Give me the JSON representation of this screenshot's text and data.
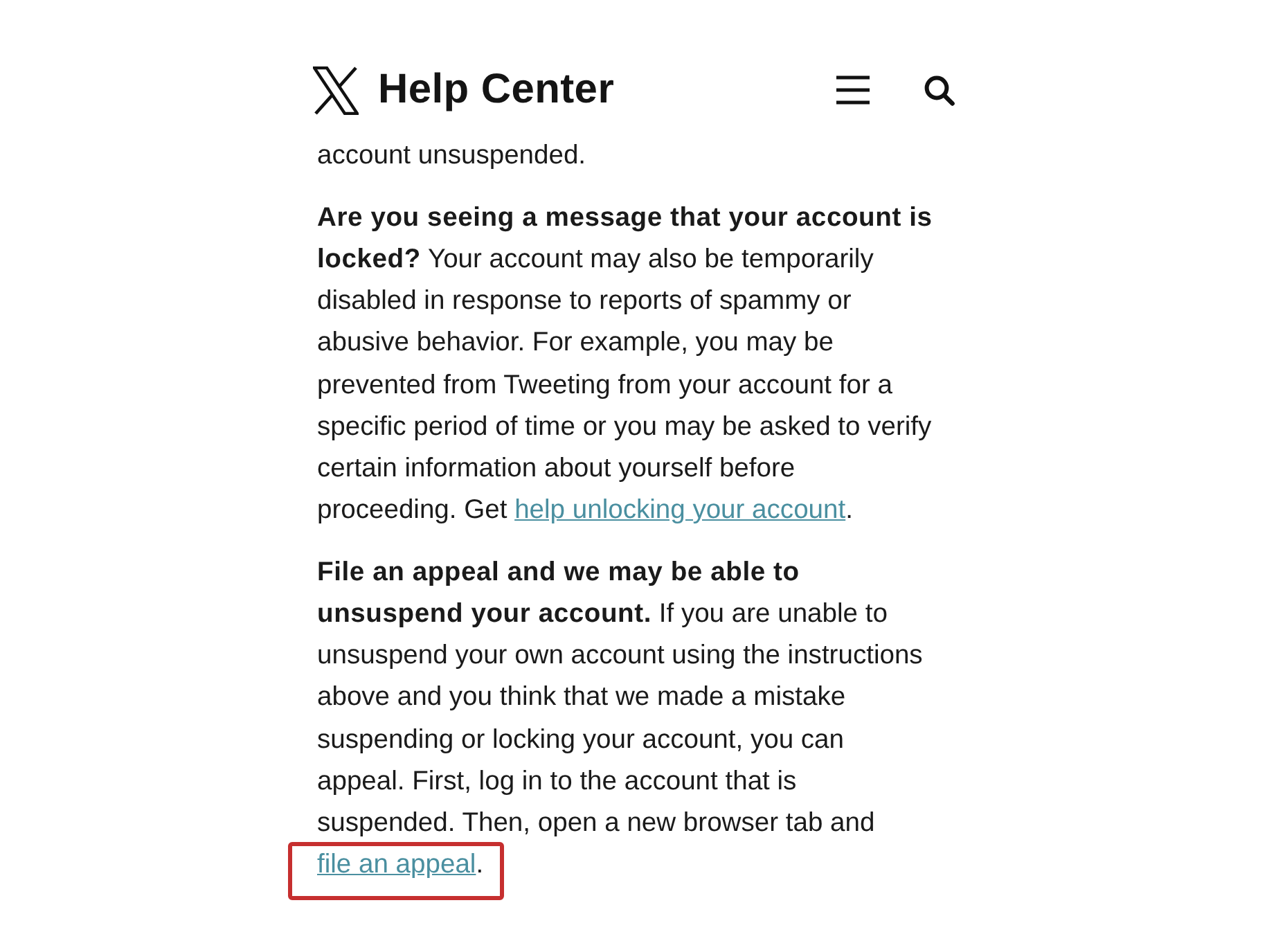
{
  "header": {
    "title": "Help Center"
  },
  "intro": "account unsuspended.",
  "paragraphs": [
    {
      "heading": "Are you seeing a message that your account is locked?",
      "text": "Your account may also be temporarily disabled in response to reports of spammy or abusive behavior. For example, you may be prevented from Tweeting from your account for a specific period of time or you may be asked to verify certain information about yourself before proceeding. Get",
      "link": "help unlocking your account",
      "after": ".",
      "highlighted": false
    },
    {
      "heading": "File an appeal and we may be able to unsuspend your account.",
      "text": "If you are unable to unsuspend your own account using the instructions above and you think that we made a mistake suspending or locking your account, you can appeal. First, log in to the account that is suspended. Then, open a new browser tab and",
      "link": "file an appeal",
      "after": ".",
      "highlighted": true
    }
  ]
}
